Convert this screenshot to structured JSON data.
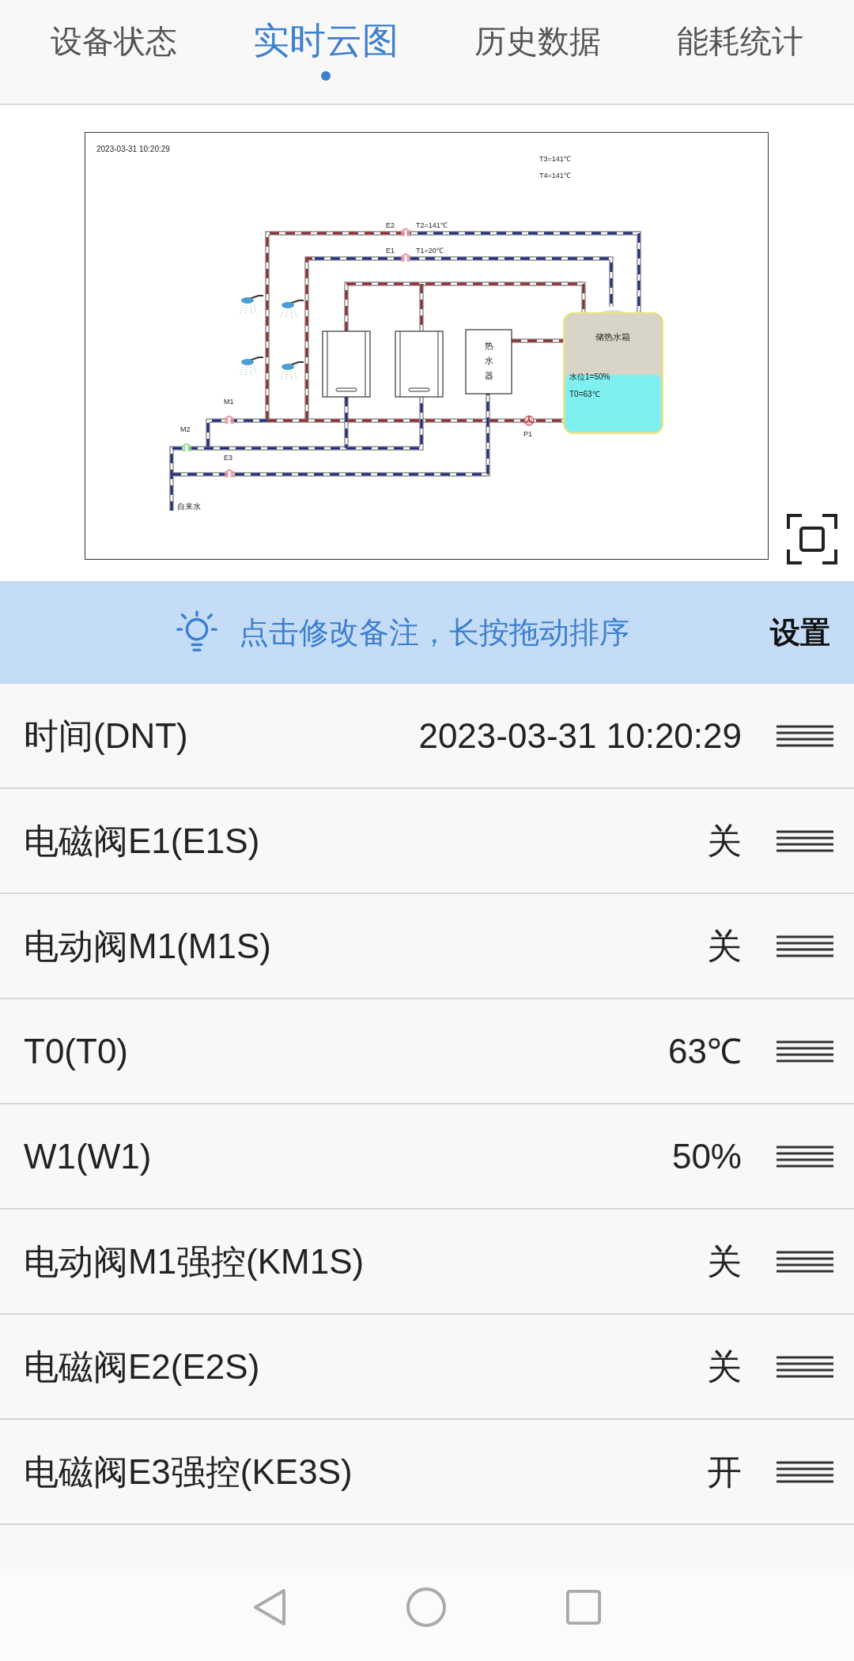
{
  "tabs": [
    {
      "label": "设备状态",
      "selected": false
    },
    {
      "label": "实时云图",
      "selected": true
    },
    {
      "label": "历史数据",
      "selected": false
    },
    {
      "label": "能耗统计",
      "selected": false
    }
  ],
  "diagram": {
    "timestamp": "2023-03-31 10:20:29",
    "t3": "T3=141℃",
    "t4": "T4=141℃",
    "e2": "E2",
    "t2": "T2=141℃",
    "e1": "E1",
    "t1": "T1=20℃",
    "m1": "M1",
    "m2": "M2",
    "e3": "E3",
    "p1": "P1",
    "inlet": "自来水",
    "heater": [
      "热",
      "水",
      "器"
    ],
    "tank": {
      "title": "储热水箱",
      "level_text": "水位1=50%",
      "temp_text": "T0=63℃",
      "level": 0.5
    }
  },
  "tip": {
    "text": "点击修改备注，长按拖动排序",
    "settings": "设置"
  },
  "rows": [
    {
      "label": "时间(DNT)",
      "value": "2023-03-31 10:20:29"
    },
    {
      "label": "电磁阀E1(E1S)",
      "value": "关"
    },
    {
      "label": "电动阀M1(M1S)",
      "value": "关"
    },
    {
      "label": "T0(T0)",
      "value": "63℃"
    },
    {
      "label": "W1(W1)",
      "value": "50%"
    },
    {
      "label": "电动阀M1强控(KM1S)",
      "value": "关"
    },
    {
      "label": "电磁阀E2(E2S)",
      "value": "关"
    },
    {
      "label": "电磁阀E3强控(KE3S)",
      "value": "开"
    }
  ]
}
